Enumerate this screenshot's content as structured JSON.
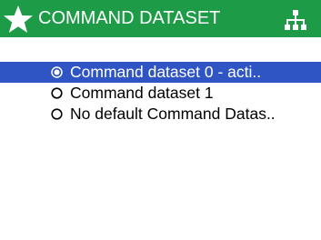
{
  "header": {
    "title": "COMMAND DATASET",
    "left_icon": "star-icon",
    "right_icon": "network-icon"
  },
  "list": {
    "items": [
      {
        "label": "Command dataset 0 - acti..",
        "selected": true
      },
      {
        "label": "Command dataset 1",
        "selected": false
      },
      {
        "label": "No default Command Datas..",
        "selected": false
      }
    ]
  },
  "colors": {
    "header_bg": "#1d9b47",
    "selection_bg": "#2f55c5"
  }
}
